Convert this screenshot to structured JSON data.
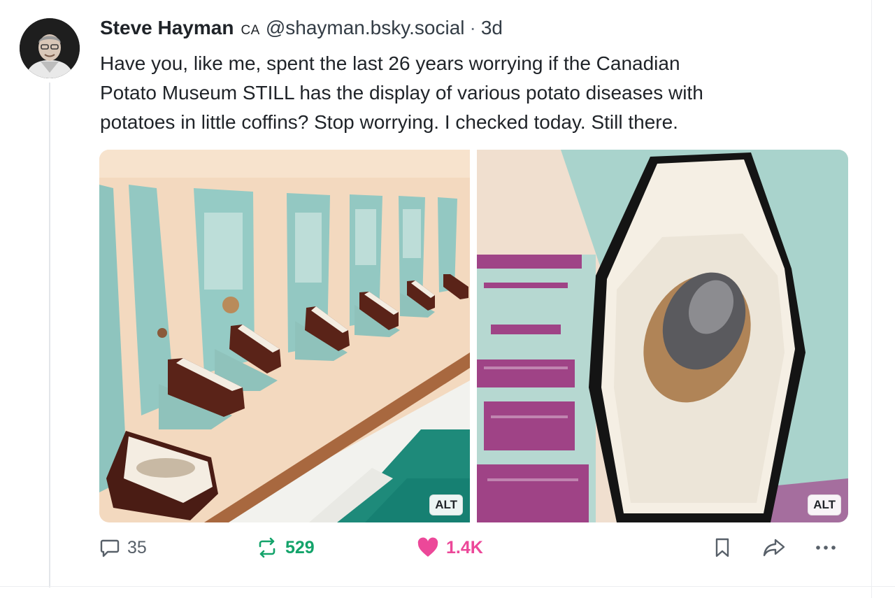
{
  "post": {
    "author_name": "Steve Hayman",
    "author_flag": "CA",
    "handle": "@shayman.bsky.social",
    "separator": "·",
    "age": "3d",
    "text_lines": [
      "Have you, like me, spent the last 26 years worrying if the Canadian",
      "Potato Museum STILL has the display of various potato diseases with",
      "potatoes in little coffins?  Stop worrying. I checked today. Still there."
    ]
  },
  "media": {
    "left_alt_label": "ALT",
    "right_alt_label": "ALT"
  },
  "actions": {
    "replies": "35",
    "reposts": "529",
    "likes": "1.4K"
  },
  "colors": {
    "repost_green": "#13a36a",
    "like_pink": "#ec4899",
    "muted_gray": "#586069"
  },
  "icons": [
    "reply-icon",
    "repost-icon",
    "heart-icon",
    "bookmark-icon",
    "share-icon",
    "more-icon"
  ]
}
